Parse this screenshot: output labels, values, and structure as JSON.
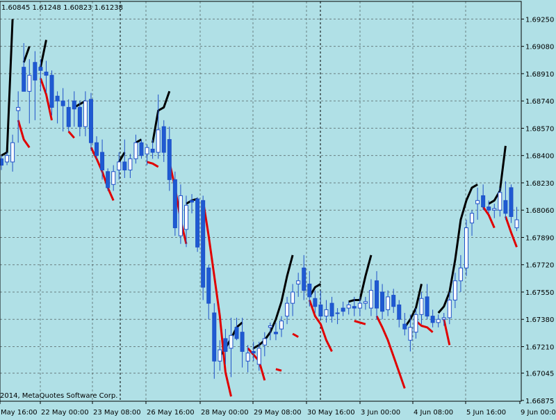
{
  "header": {
    "ohlc_text": "1.60845 1.61248 1.60823 1.61238"
  },
  "footer": {
    "copyright": "2014, MetaQuotes Software Corp."
  },
  "colors": {
    "background": "#b0e0e6",
    "grid": "#303030",
    "bull_body": "#ffffff",
    "bear_body": "#1e5ad2",
    "candle_edge": "#1e50c8",
    "upper_line": "#000000",
    "lower_line": "#e00000"
  },
  "chart_data": {
    "type": "candlestick",
    "instrument_note": "price chart with envelope-style indicator lines",
    "ylim": [
      1.6687,
      1.6936
    ],
    "y_ticks": [
      "1.69250",
      "1.69080",
      "1.68910",
      "1.68740",
      "1.68570",
      "1.68400",
      "1.68230",
      "1.68060",
      "1.67890",
      "1.67720",
      "1.67550",
      "1.67380",
      "1.67210",
      "1.67045",
      "1.66875"
    ],
    "x_tick_labels": [
      "May 16:00",
      "22 May 00:00",
      "23 May 08:00",
      "26 May 16:00",
      "28 May 00:00",
      "29 May 08:00",
      "30 May 16:00",
      "3 Jun 00:00",
      "4 Jun 08:00",
      "5 Jun 16:00",
      "9 Jun 00:0"
    ],
    "candles": [
      {
        "o": 1.6838,
        "h": 1.684,
        "l": 1.6831,
        "c": 1.6834
      },
      {
        "o": 1.6836,
        "h": 1.6842,
        "l": 1.6834,
        "c": 1.684
      },
      {
        "o": 1.6836,
        "h": 1.6853,
        "l": 1.683,
        "c": 1.6848
      },
      {
        "o": 1.6868,
        "h": 1.688,
        "l": 1.6848,
        "c": 1.687
      },
      {
        "o": 1.6895,
        "h": 1.691,
        "l": 1.689,
        "c": 1.688
      },
      {
        "o": 1.688,
        "h": 1.69,
        "l": 1.686,
        "c": 1.689
      },
      {
        "o": 1.6898,
        "h": 1.6905,
        "l": 1.6862,
        "c": 1.6887
      },
      {
        "o": 1.6895,
        "h": 1.69,
        "l": 1.688,
        "c": 1.6893
      },
      {
        "o": 1.6892,
        "h": 1.6899,
        "l": 1.6879,
        "c": 1.689
      },
      {
        "o": 1.689,
        "h": 1.6893,
        "l": 1.6865,
        "c": 1.687
      },
      {
        "o": 1.6877,
        "h": 1.688,
        "l": 1.686,
        "c": 1.6874
      },
      {
        "o": 1.6874,
        "h": 1.6882,
        "l": 1.6855,
        "c": 1.6871
      },
      {
        "o": 1.687,
        "h": 1.6875,
        "l": 1.6855,
        "c": 1.6858
      },
      {
        "o": 1.6874,
        "h": 1.688,
        "l": 1.6858,
        "c": 1.6869
      },
      {
        "o": 1.687,
        "h": 1.6874,
        "l": 1.6852,
        "c": 1.6858
      },
      {
        "o": 1.6858,
        "h": 1.688,
        "l": 1.6852,
        "c": 1.6874
      },
      {
        "o": 1.6875,
        "h": 1.6879,
        "l": 1.6843,
        "c": 1.6848
      },
      {
        "o": 1.6848,
        "h": 1.6852,
        "l": 1.6838,
        "c": 1.684
      },
      {
        "o": 1.6842,
        "h": 1.685,
        "l": 1.6825,
        "c": 1.6831
      },
      {
        "o": 1.683,
        "h": 1.6832,
        "l": 1.6818,
        "c": 1.682
      },
      {
        "o": 1.6822,
        "h": 1.6834,
        "l": 1.6818,
        "c": 1.683
      },
      {
        "o": 1.6831,
        "h": 1.6842,
        "l": 1.6825,
        "c": 1.6836
      },
      {
        "o": 1.6836,
        "h": 1.685,
        "l": 1.6826,
        "c": 1.6831
      },
      {
        "o": 1.6831,
        "h": 1.6841,
        "l": 1.6826,
        "c": 1.6838
      },
      {
        "o": 1.6838,
        "h": 1.6853,
        "l": 1.6835,
        "c": 1.6848
      },
      {
        "o": 1.6848,
        "h": 1.685,
        "l": 1.6838,
        "c": 1.684
      },
      {
        "o": 1.6841,
        "h": 1.6847,
        "l": 1.6834,
        "c": 1.6845
      },
      {
        "o": 1.6844,
        "h": 1.685,
        "l": 1.6838,
        "c": 1.6842
      },
      {
        "o": 1.6842,
        "h": 1.6878,
        "l": 1.6838,
        "c": 1.6856
      },
      {
        "o": 1.6858,
        "h": 1.6862,
        "l": 1.6836,
        "c": 1.6842
      },
      {
        "o": 1.685,
        "h": 1.6858,
        "l": 1.6818,
        "c": 1.6825
      },
      {
        "o": 1.6825,
        "h": 1.683,
        "l": 1.679,
        "c": 1.6795
      },
      {
        "o": 1.679,
        "h": 1.6822,
        "l": 1.6785,
        "c": 1.6815
      },
      {
        "o": 1.6794,
        "h": 1.6815,
        "l": 1.6783,
        "c": 1.6809
      },
      {
        "o": 1.6812,
        "h": 1.6816,
        "l": 1.6804,
        "c": 1.6811
      },
      {
        "o": 1.6813,
        "h": 1.6814,
        "l": 1.678,
        "c": 1.6783
      },
      {
        "o": 1.6812,
        "h": 1.6815,
        "l": 1.675,
        "c": 1.6758
      },
      {
        "o": 1.677,
        "h": 1.6772,
        "l": 1.6738,
        "c": 1.6748
      },
      {
        "o": 1.6742,
        "h": 1.6748,
        "l": 1.6701,
        "c": 1.6712
      },
      {
        "o": 1.6712,
        "h": 1.6725,
        "l": 1.6706,
        "c": 1.6719
      },
      {
        "o": 1.6726,
        "h": 1.6732,
        "l": 1.671,
        "c": 1.6718
      },
      {
        "o": 1.672,
        "h": 1.6739,
        "l": 1.6702,
        "c": 1.6728
      },
      {
        "o": 1.6733,
        "h": 1.6739,
        "l": 1.6725,
        "c": 1.6726
      },
      {
        "o": 1.673,
        "h": 1.6739,
        "l": 1.6708,
        "c": 1.6718
      },
      {
        "o": 1.6712,
        "h": 1.6722,
        "l": 1.6705,
        "c": 1.6717
      },
      {
        "o": 1.6718,
        "h": 1.6724,
        "l": 1.6712,
        "c": 1.6717
      },
      {
        "o": 1.671,
        "h": 1.6724,
        "l": 1.6706,
        "c": 1.672
      },
      {
        "o": 1.6722,
        "h": 1.673,
        "l": 1.6715,
        "c": 1.6726
      },
      {
        "o": 1.6733,
        "h": 1.6736,
        "l": 1.6725,
        "c": 1.6734
      },
      {
        "o": 1.673,
        "h": 1.6736,
        "l": 1.6725,
        "c": 1.6729
      },
      {
        "o": 1.6732,
        "h": 1.674,
        "l": 1.6727,
        "c": 1.6737
      },
      {
        "o": 1.674,
        "h": 1.6752,
        "l": 1.6735,
        "c": 1.6748
      },
      {
        "o": 1.6748,
        "h": 1.676,
        "l": 1.674,
        "c": 1.6755
      },
      {
        "o": 1.676,
        "h": 1.6767,
        "l": 1.6752,
        "c": 1.6762
      },
      {
        "o": 1.677,
        "h": 1.6778,
        "l": 1.675,
        "c": 1.6756
      },
      {
        "o": 1.676,
        "h": 1.6768,
        "l": 1.6746,
        "c": 1.6752
      },
      {
        "o": 1.6751,
        "h": 1.6756,
        "l": 1.6742,
        "c": 1.6746
      },
      {
        "o": 1.6747,
        "h": 1.6756,
        "l": 1.6738,
        "c": 1.674
      },
      {
        "o": 1.674,
        "h": 1.675,
        "l": 1.6736,
        "c": 1.6744
      },
      {
        "o": 1.6748,
        "h": 1.6752,
        "l": 1.6736,
        "c": 1.674
      },
      {
        "o": 1.6742,
        "h": 1.6745,
        "l": 1.6735,
        "c": 1.6742
      },
      {
        "o": 1.6745,
        "h": 1.6749,
        "l": 1.674,
        "c": 1.6743
      },
      {
        "o": 1.6745,
        "h": 1.6749,
        "l": 1.6741,
        "c": 1.6747
      },
      {
        "o": 1.6746,
        "h": 1.6752,
        "l": 1.674,
        "c": 1.6745
      },
      {
        "o": 1.6745,
        "h": 1.6752,
        "l": 1.674,
        "c": 1.6748
      },
      {
        "o": 1.6748,
        "h": 1.6752,
        "l": 1.6744,
        "c": 1.6749
      },
      {
        "o": 1.6745,
        "h": 1.6763,
        "l": 1.674,
        "c": 1.6756
      },
      {
        "o": 1.6762,
        "h": 1.6768,
        "l": 1.6738,
        "c": 1.6745
      },
      {
        "o": 1.6755,
        "h": 1.676,
        "l": 1.6738,
        "c": 1.6743
      },
      {
        "o": 1.6744,
        "h": 1.6756,
        "l": 1.674,
        "c": 1.6752
      },
      {
        "o": 1.6753,
        "h": 1.6757,
        "l": 1.6742,
        "c": 1.6746
      },
      {
        "o": 1.6747,
        "h": 1.675,
        "l": 1.6733,
        "c": 1.6738
      },
      {
        "o": 1.6735,
        "h": 1.6742,
        "l": 1.6728,
        "c": 1.6732
      },
      {
        "o": 1.6725,
        "h": 1.6741,
        "l": 1.6718,
        "c": 1.6733
      },
      {
        "o": 1.673,
        "h": 1.6745,
        "l": 1.6726,
        "c": 1.6741
      },
      {
        "o": 1.6741,
        "h": 1.6755,
        "l": 1.6735,
        "c": 1.6751
      },
      {
        "o": 1.6752,
        "h": 1.676,
        "l": 1.6738,
        "c": 1.674
      },
      {
        "o": 1.674,
        "h": 1.6744,
        "l": 1.6733,
        "c": 1.6736
      },
      {
        "o": 1.6736,
        "h": 1.6741,
        "l": 1.6733,
        "c": 1.6738
      },
      {
        "o": 1.6738,
        "h": 1.6742,
        "l": 1.6734,
        "c": 1.6739
      },
      {
        "o": 1.6739,
        "h": 1.6755,
        "l": 1.6735,
        "c": 1.675
      },
      {
        "o": 1.675,
        "h": 1.6767,
        "l": 1.6745,
        "c": 1.6762
      },
      {
        "o": 1.6762,
        "h": 1.6778,
        "l": 1.6755,
        "c": 1.677
      },
      {
        "o": 1.677,
        "h": 1.68,
        "l": 1.6765,
        "c": 1.6795
      },
      {
        "o": 1.6798,
        "h": 1.6806,
        "l": 1.679,
        "c": 1.6804
      },
      {
        "o": 1.681,
        "h": 1.682,
        "l": 1.68,
        "c": 1.6812
      },
      {
        "o": 1.6815,
        "h": 1.6822,
        "l": 1.6806,
        "c": 1.6808
      },
      {
        "o": 1.6808,
        "h": 1.6812,
        "l": 1.6804,
        "c": 1.6806
      },
      {
        "o": 1.6806,
        "h": 1.681,
        "l": 1.6801,
        "c": 1.6807
      },
      {
        "o": 1.6806,
        "h": 1.682,
        "l": 1.6802,
        "c": 1.6817
      },
      {
        "o": 1.6812,
        "h": 1.6824,
        "l": 1.68,
        "c": 1.6804
      },
      {
        "o": 1.682,
        "h": 1.6822,
        "l": 1.6798,
        "c": 1.6802
      },
      {
        "o": 1.6795,
        "h": 1.6808,
        "l": 1.6793,
        "c": 1.68
      }
    ],
    "upper_line": [
      1.684,
      1.6842,
      1.6925,
      null,
      1.6898,
      1.6908,
      null,
      1.6895,
      1.6912,
      null,
      null,
      null,
      null,
      1.687,
      1.6872,
      1.6874,
      null,
      null,
      null,
      null,
      null,
      1.6836,
      1.6842,
      null,
      1.6848,
      1.685,
      null,
      1.6848,
      1.6868,
      1.687,
      1.688,
      null,
      null,
      1.681,
      1.6812,
      1.6813,
      null,
      null,
      null,
      1.6715,
      1.672,
      1.6726,
      1.6733,
      1.6736,
      null,
      1.672,
      1.6722,
      1.6725,
      1.673,
      1.6738,
      1.6749,
      1.6765,
      1.6778,
      null,
      null,
      1.6752,
      1.6758,
      1.676,
      null,
      null,
      null,
      null,
      1.6749,
      1.675,
      1.675,
      1.6765,
      1.6778,
      null,
      null,
      null,
      null,
      null,
      1.6733,
      1.6738,
      1.6745,
      1.676,
      null,
      null,
      1.6742,
      1.6746,
      1.6755,
      1.6775,
      1.68,
      1.6812,
      1.682,
      1.6822,
      null,
      1.681,
      1.6812,
      1.6818,
      1.6846,
      null,
      null
    ],
    "lower_line": [
      null,
      null,
      null,
      1.6862,
      1.685,
      1.6845,
      null,
      1.6888,
      1.6878,
      1.6862,
      null,
      null,
      1.6855,
      1.6851,
      null,
      null,
      1.6845,
      1.6838,
      1.683,
      1.682,
      1.6812,
      null,
      null,
      null,
      null,
      null,
      1.6836,
      1.6835,
      1.6833,
      null,
      1.6836,
      1.682,
      1.68,
      1.6785,
      null,
      null,
      1.6812,
      1.679,
      1.6765,
      1.674,
      1.6705,
      1.669,
      null,
      null,
      1.672,
      1.6716,
      1.6712,
      1.67,
      null,
      1.6707,
      1.6706,
      null,
      1.6729,
      1.6727,
      null,
      1.675,
      1.674,
      1.6735,
      1.6725,
      1.6718,
      null,
      null,
      null,
      1.6737,
      1.6736,
      1.6735,
      null,
      1.674,
      1.6733,
      1.6725,
      1.6715,
      1.6705,
      1.6695,
      null,
      1.6737,
      1.6734,
      1.6733,
      1.673,
      null,
      1.6738,
      1.6722,
      null,
      null,
      null,
      null,
      null,
      1.6808,
      1.6803,
      1.6795,
      null,
      1.6802,
      1.6792,
      1.6783
    ]
  }
}
